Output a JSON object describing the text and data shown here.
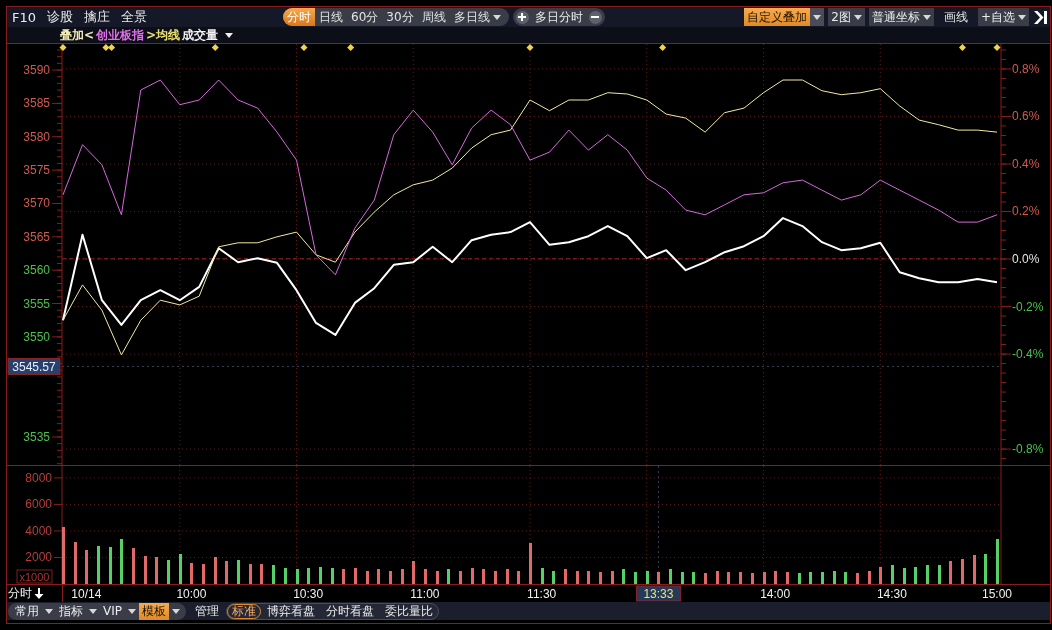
{
  "toolbar": {
    "nav": [
      "F10",
      "诊股",
      "擒庄",
      "全景"
    ],
    "periods": [
      {
        "label": "分时",
        "kind": "tab",
        "selected": true
      },
      {
        "label": "日线",
        "kind": "tab",
        "selected": false
      },
      {
        "label": "60分",
        "kind": "tab",
        "selected": false
      },
      {
        "label": "30分",
        "kind": "tab",
        "selected": false
      },
      {
        "label": "周线",
        "kind": "tab",
        "selected": false
      },
      {
        "label": "多日线",
        "kind": "dropdown",
        "selected": false
      }
    ],
    "multi_day": "多日分时",
    "tools": [
      {
        "label": "自定义叠加",
        "kind": "split",
        "active": true
      },
      {
        "label": "2图",
        "kind": "dropdown",
        "active": false
      },
      {
        "label": "普通坐标",
        "kind": "dropdown",
        "active": false
      },
      {
        "label": "画线",
        "kind": "plain",
        "active": false
      },
      {
        "label": "+自选",
        "kind": "dropdown",
        "active": false
      }
    ]
  },
  "legend": {
    "items": [
      {
        "text": "叠加<",
        "color": "#f2eab4"
      },
      {
        "text": "创业板指",
        "color": "#e070ea"
      },
      {
        "text": ">均线",
        "color": "#ece070"
      },
      {
        "text": "成交量",
        "color": "#f2f2f2"
      }
    ]
  },
  "price_chart": {
    "chart_data": {
      "type": "line",
      "grid": true,
      "categories": [
        null,
        null,
        null,
        null,
        null,
        null,
        null,
        null,
        null,
        null,
        null,
        null,
        null,
        null,
        null,
        null,
        null,
        null,
        null,
        null,
        null,
        null,
        null,
        null,
        null,
        null,
        null,
        null,
        null,
        null,
        null,
        null,
        null,
        null,
        null,
        null,
        null,
        null,
        null,
        null,
        null,
        null,
        null,
        null,
        null,
        null,
        null,
        null,
        null
      ],
      "ylim": [
        3530.8,
        3593.9
      ],
      "y2lim": [
        -0.867,
        0.905
      ],
      "yticks": [
        3535,
        3550,
        3555,
        3560,
        3565,
        3570,
        3575,
        3580,
        3585,
        3590
      ],
      "y2ticks": [
        {
          "value": 0.8,
          "label": "0.8%"
        },
        {
          "value": 0.6,
          "label": "0.6%"
        },
        {
          "value": 0.4,
          "label": "0.4%"
        },
        {
          "value": 0.2,
          "label": "0.2%"
        },
        {
          "value": 0,
          "label": "0.0%"
        },
        {
          "value": -0.2,
          "label": "-0.2%"
        },
        {
          "value": -0.4,
          "label": "-0.4%"
        },
        {
          "value": -0.8,
          "label": "-0.8%"
        }
      ],
      "ref_lines": [
        {
          "axis": "y",
          "value": 3561.7
        },
        {
          "axis": "y",
          "value": 3545.57,
          "label": "3545.57"
        }
      ],
      "series": [
        {
          "color": "#ffffff",
          "values": [
            3552.5,
            3565.3,
            3555.5,
            3551.8,
            3555.5,
            3557.0,
            3555.5,
            3557.5,
            3563.3,
            3561.2,
            3561.8,
            3561.1,
            3557.0,
            3552.1,
            3550.3,
            3555.1,
            3557.3,
            3560.8,
            3561.2,
            3563.5,
            3561.2,
            3564.5,
            3565.3,
            3565.7,
            3567.2,
            3563.8,
            3564.2,
            3565.1,
            3566.6,
            3565.1,
            3561.8,
            3563.0,
            3560.0,
            3561.2,
            3562.7,
            3563.6,
            3565.1,
            3567.8,
            3566.6,
            3564.2,
            3563.0,
            3563.3,
            3564.1,
            3559.7,
            3558.8,
            3558.2,
            3558.2,
            3558.7,
            3558.2
          ]
        },
        {
          "color": "#f0eaa0",
          "values": [
            3552.5,
            3557.8,
            3554.0,
            3547.3,
            3552.5,
            3555.5,
            3554.8,
            3556.1,
            3563.5,
            3564.1,
            3564.1,
            3565.0,
            3565.7,
            3562.3,
            3561.2,
            3565.7,
            3568.7,
            3571.3,
            3572.8,
            3573.5,
            3575.3,
            3578.3,
            3580.3,
            3581.0,
            3585.5,
            3583.9,
            3585.5,
            3585.5,
            3586.6,
            3586.4,
            3585.5,
            3583.4,
            3582.8,
            3580.7,
            3583.6,
            3584.3,
            3586.6,
            3588.5,
            3588.5,
            3586.9,
            3586.3,
            3586.6,
            3587.2,
            3584.6,
            3582.5,
            3581.8,
            3581.0,
            3581.0,
            3580.7
          ]
        },
        {
          "color": "#d468dc",
          "values": [
            3571.3,
            3578.8,
            3575.8,
            3568.3,
            3587.0,
            3588.5,
            3584.8,
            3585.5,
            3588.5,
            3585.5,
            3584.3,
            3580.7,
            3576.5,
            3562.3,
            3559.3,
            3566.3,
            3570.5,
            3580.3,
            3584.0,
            3580.7,
            3575.8,
            3581.3,
            3584.0,
            3581.8,
            3576.5,
            3577.7,
            3581.0,
            3578.0,
            3580.3,
            3578.0,
            3573.8,
            3572.0,
            3569.0,
            3568.3,
            3569.8,
            3571.3,
            3571.6,
            3573.1,
            3573.5,
            3572.0,
            3570.5,
            3571.3,
            3573.5,
            3572.0,
            3570.5,
            3569.0,
            3567.2,
            3567.2,
            3568.3
          ]
        }
      ]
    }
  },
  "volume_chart": {
    "chart_data": {
      "type": "bar",
      "grid": true,
      "ylabel": "x1000",
      "categories": [
        null,
        null,
        "10/14",
        null,
        null,
        null,
        null,
        null,
        null,
        null,
        null,
        "10:00",
        null,
        null,
        null,
        null,
        null,
        null,
        null,
        null,
        null,
        "10:30",
        null,
        null,
        null,
        null,
        null,
        null,
        null,
        null,
        null,
        "11:00",
        null,
        null,
        null,
        null,
        null,
        null,
        null,
        null,
        null,
        "11:30",
        null,
        null,
        null,
        null,
        null,
        null,
        null,
        null,
        null,
        "13:33",
        null,
        null,
        null,
        null,
        null,
        null,
        null,
        null,
        null,
        "14:00",
        null,
        null,
        null,
        null,
        null,
        null,
        null,
        null,
        null,
        "14:30",
        null,
        null,
        null,
        null,
        null,
        null,
        null,
        null,
        "15:00"
      ],
      "ylim": [
        0,
        8900
      ],
      "yticks": [
        2000,
        4000,
        6000,
        8000
      ],
      "ref_lines": [
        {
          "axis": "x",
          "value": "13:33"
        }
      ],
      "values": [
        4300,
        3200,
        2600,
        2900,
        2800,
        3400,
        2700,
        2100,
        2000,
        1800,
        2300,
        1600,
        1500,
        2000,
        1700,
        1800,
        1500,
        1500,
        1400,
        1200,
        1100,
        1200,
        1300,
        1200,
        1100,
        1200,
        1000,
        1100,
        1000,
        1100,
        1700,
        1100,
        1000,
        1100,
        1000,
        1200,
        1100,
        1000,
        1100,
        1000,
        3100,
        1200,
        1000,
        1100,
        1000,
        1000,
        900,
        1000,
        1100,
        900,
        1000,
        900,
        1100,
        900,
        900,
        800,
        1000,
        900,
        900,
        800,
        900,
        1000,
        900,
        800,
        900,
        900,
        1000,
        900,
        800,
        1000,
        1300,
        1400,
        1200,
        1300,
        1400,
        1400,
        1700,
        1900,
        2200,
        2300,
        3400
      ]
    }
  },
  "time_menu": {
    "label": "分时"
  },
  "bottom_bar": {
    "menus": [
      {
        "label": "常用",
        "active": false
      },
      {
        "label": "指标",
        "active": false
      },
      {
        "label": "VIP",
        "active": false
      },
      {
        "label": "模板",
        "active": true
      }
    ],
    "manage": "管理",
    "views": [
      {
        "label": "标准",
        "selected": true
      },
      {
        "label": "博弈看盘",
        "selected": false
      },
      {
        "label": "分时看盘",
        "selected": false
      },
      {
        "label": "委比量比",
        "selected": false
      }
    ]
  }
}
